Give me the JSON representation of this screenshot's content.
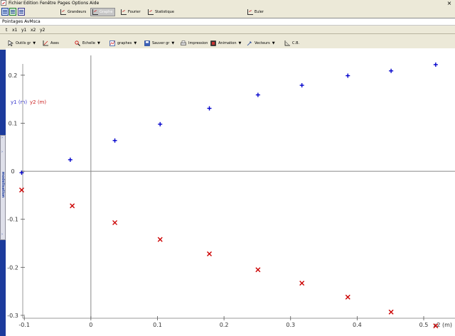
{
  "menu": {
    "items": [
      "Fichier",
      "Edition",
      "Fenêtre",
      "Pages",
      "Options",
      "Aide"
    ],
    "close_glyph": "×"
  },
  "toolbar": {
    "tabs": [
      "Grandeurs",
      "Graphe",
      "Fourier",
      "Statistique",
      "Euler"
    ]
  },
  "page_title": "Pointages AvMsca",
  "variables": [
    "t",
    "x1",
    "y1",
    "x2",
    "y2"
  ],
  "graph_toolbar": {
    "items": [
      "Outils gr",
      "Axes",
      "Echelle",
      "graphes",
      "Sauver gr",
      "Impression",
      "Animation",
      "Vecteurs",
      "C.B."
    ]
  },
  "side_panel": {
    "label": "modélisation",
    "arrow": "›"
  },
  "chart_data": {
    "type": "scatter",
    "y_axis_labels": [
      {
        "text": "y1 (m)",
        "color": "#3333cc"
      },
      {
        "text": "y2 (m)",
        "color": "#cc2222"
      }
    ],
    "xlabel": "x2 (m)",
    "xlim": [
      -0.128,
      0.547
    ],
    "ylim": [
      -0.343,
      0.256
    ],
    "x_ticks": [
      -0.1,
      0,
      0.1,
      0.2,
      0.3,
      0.4,
      0.5
    ],
    "x_tick_labels": [
      "-0.1",
      "0",
      "0.1",
      "0.2",
      "0.3",
      "0.4",
      "0.5"
    ],
    "y_ticks": [
      0.2,
      0.1,
      0,
      -0.1,
      -0.2,
      -0.3
    ],
    "y_tick_labels": [
      "0.2",
      "0.1",
      "0",
      "-0.1",
      "-0.2",
      "-0.3"
    ],
    "grid": false,
    "series": [
      {
        "marker": "+",
        "color": "#0000cc",
        "x": [
          -0.104,
          -0.031,
          0.036,
          0.104,
          0.178,
          0.251,
          0.317,
          0.386,
          0.451,
          0.518
        ],
        "y": [
          -0.003,
          0.024,
          0.064,
          0.098,
          0.131,
          0.159,
          0.179,
          0.199,
          0.209,
          0.222
        ]
      },
      {
        "marker": "x",
        "color": "#cc0000",
        "x": [
          -0.104,
          -0.028,
          0.036,
          0.104,
          0.178,
          0.251,
          0.317,
          0.386,
          0.451,
          0.518
        ],
        "y": [
          -0.039,
          -0.072,
          -0.107,
          -0.142,
          -0.172,
          -0.205,
          -0.233,
          -0.262,
          -0.293,
          -0.322
        ]
      }
    ]
  }
}
